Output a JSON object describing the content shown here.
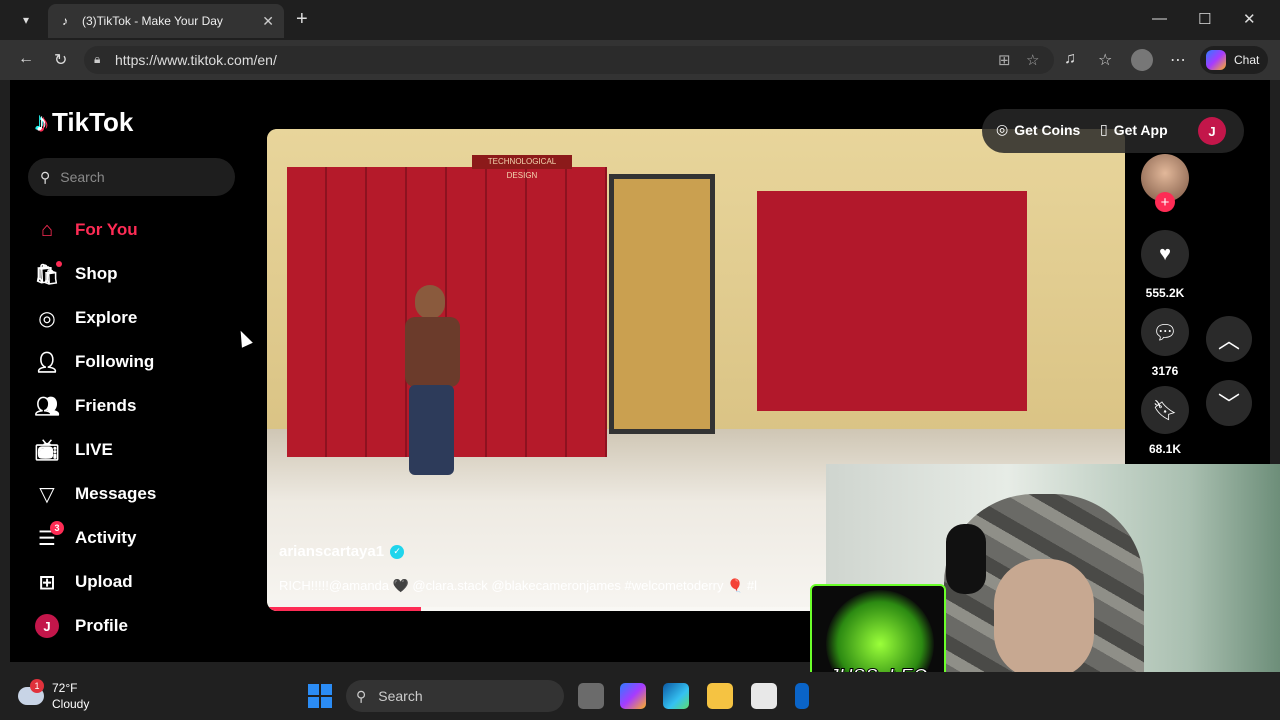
{
  "browser": {
    "tab_title": "(3)TikTok - Make Your Day",
    "url": "https://www.tiktok.com/en/",
    "chat_label": "Chat"
  },
  "tiktok": {
    "logo_text": "TikTok",
    "search_placeholder": "Search",
    "nav": [
      {
        "label": "For You",
        "icon": "home-icon",
        "active": true
      },
      {
        "label": "Shop",
        "icon": "shopping-bag-icon"
      },
      {
        "label": "Explore",
        "icon": "compass-icon"
      },
      {
        "label": "Following",
        "icon": "user-add-icon"
      },
      {
        "label": "Friends",
        "icon": "users-icon"
      },
      {
        "label": "LIVE",
        "icon": "live-tv-icon"
      },
      {
        "label": "Messages",
        "icon": "send-icon"
      },
      {
        "label": "Activity",
        "icon": "activity-icon",
        "badge": "3"
      },
      {
        "label": "Upload",
        "icon": "plus-square-icon"
      },
      {
        "label": "Profile",
        "icon": "avatar-icon",
        "avatar_letter": "J"
      }
    ],
    "top_actions": {
      "get_coins": "Get Coins",
      "get_app": "Get App",
      "avatar_letter": "J"
    },
    "video": {
      "username": "arianscartaya1",
      "caption": "RICH!!!!!@amanda 🖤 @clara.stack @blakecameronjames #welcometoderry 🎈 #l",
      "sign_text": "TECHNOLOGICAL DESIGN",
      "progress": 0.18
    },
    "actions": {
      "likes": "555.2K",
      "comments": "3176",
      "saves": "68.1K"
    }
  },
  "overlay": {
    "streamer_name": "JUSS_LEO",
    "platform": "kick"
  },
  "taskbar": {
    "temperature": "72°F",
    "condition": "Cloudy",
    "weather_badge": "1",
    "search_label": "Search"
  },
  "colors": {
    "accent": "#fe2c55",
    "page_bg": "#000000",
    "verified": "#20d5ec"
  }
}
